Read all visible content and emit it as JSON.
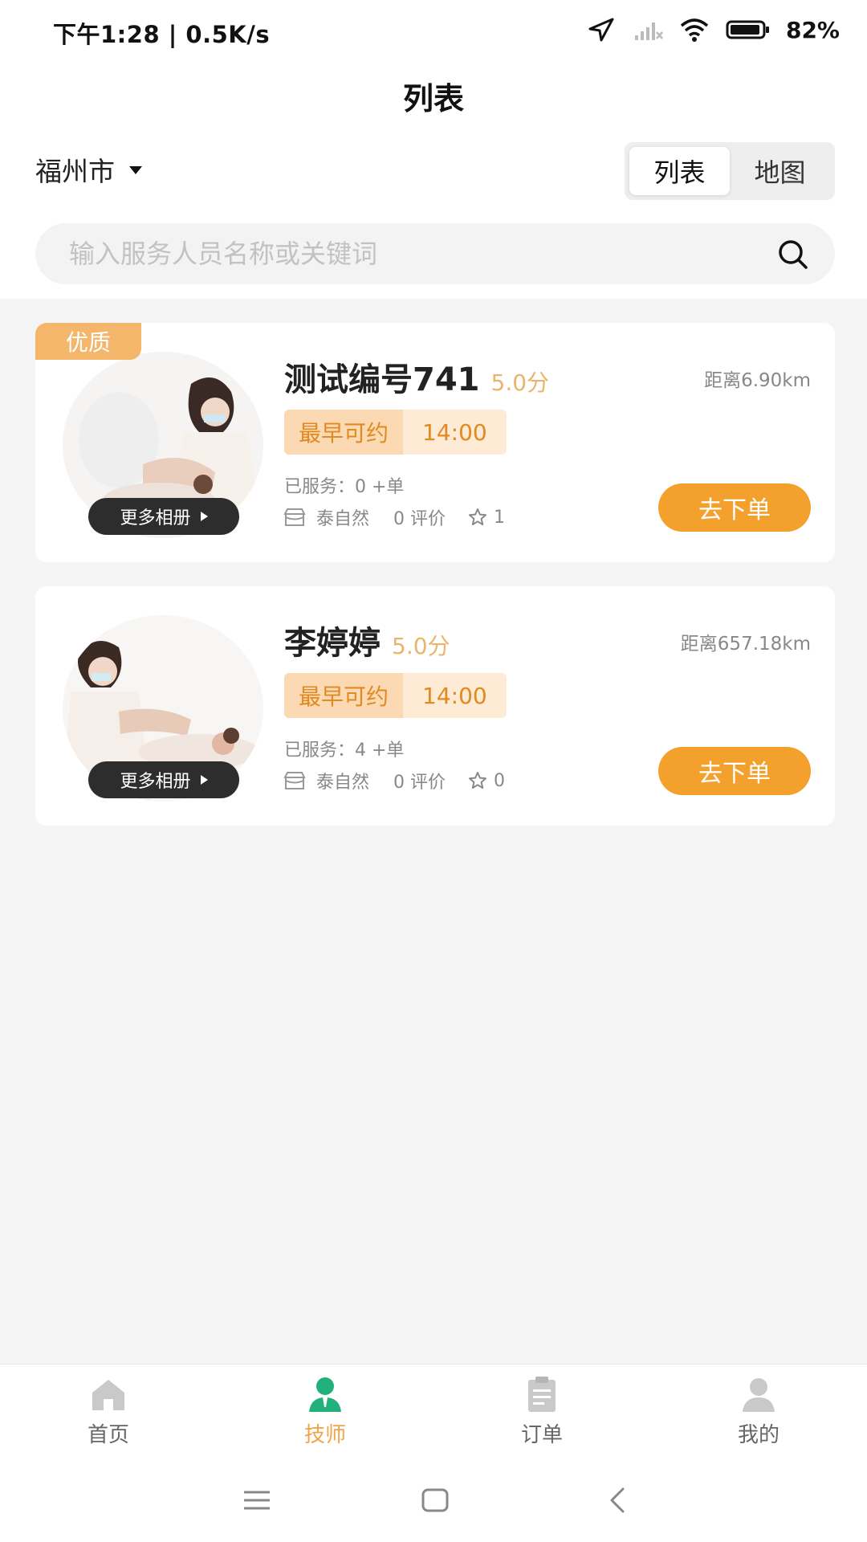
{
  "status_bar": {
    "time_speed": "下午1:28 | 0.5K/s",
    "battery": "82%"
  },
  "header": {
    "title": "列表",
    "city": "福州市",
    "toggle": {
      "list": "列表",
      "map": "地图",
      "active": "list"
    },
    "search": {
      "placeholder": "输入服务人员名称或关键词",
      "value": ""
    }
  },
  "therapists": [
    {
      "badge": "优质",
      "name": "测试编号741",
      "score": "5.0分",
      "distance": "距离6.90km",
      "earliest_label": "最早可约",
      "earliest_time": "14:00",
      "served": "已服务：0 +单",
      "store": "泰自然",
      "reviews": "0 评价",
      "stars": "1",
      "album_label": "更多相册",
      "order_label": "去下单"
    },
    {
      "badge": "",
      "name": "李婷婷",
      "score": "5.0分",
      "distance": "距离657.18km",
      "earliest_label": "最早可约",
      "earliest_time": "14:00",
      "served": "已服务：4 +单",
      "store": "泰自然",
      "reviews": "0 评价",
      "stars": "0",
      "album_label": "更多相册",
      "order_label": "去下单"
    }
  ],
  "tab_bar": [
    {
      "label": "首页",
      "icon": "home-icon",
      "active": false
    },
    {
      "label": "技师",
      "icon": "therapist-icon",
      "active": true
    },
    {
      "label": "订单",
      "icon": "order-icon",
      "active": false
    },
    {
      "label": "我的",
      "icon": "profile-icon",
      "active": false
    }
  ],
  "colors": {
    "accent": "#f3a02d",
    "score": "#e9b56b",
    "active_tab": "#f1a447",
    "active_icon": "#22b07d",
    "badge": "#f3b66b"
  }
}
